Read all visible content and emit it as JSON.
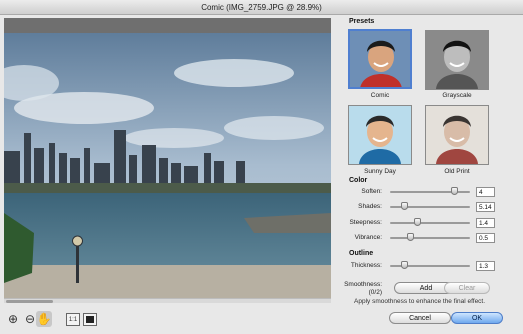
{
  "window": {
    "title": "Comic (IMG_2759.JPG @ 28.9%)"
  },
  "toolbar": {
    "zoom_in_icon": "zoom-in-icon",
    "zoom_out_icon": "zoom-out-icon",
    "hand_icon": "hand-icon",
    "actual_size_label": "1:1",
    "fit_icon": "fit-screen-icon"
  },
  "presets": {
    "heading": "Presets",
    "items": [
      {
        "label": "Comic",
        "selected": true
      },
      {
        "label": "Grayscale",
        "selected": false
      },
      {
        "label": "Sunny Day",
        "selected": false
      },
      {
        "label": "Old Print",
        "selected": false
      }
    ]
  },
  "color": {
    "heading": "Color",
    "soften": {
      "label": "Soften:",
      "value": "4",
      "fraction": 0.8
    },
    "shades": {
      "label": "Shades:",
      "value": "5.14",
      "fraction": 0.18
    },
    "steepness": {
      "label": "Steepness:",
      "value": "1.4",
      "fraction": 0.34
    },
    "vibrance": {
      "label": "Vibrance:",
      "value": "0.5",
      "fraction": 0.25
    }
  },
  "outline": {
    "heading": "Outline",
    "thickness": {
      "label": "Thickness:",
      "value": "1.3",
      "fraction": 0.18
    },
    "smoothness": {
      "label": "Smoothness:",
      "count": "(0/2)"
    },
    "add_label": "Add",
    "clear_label": "Clear",
    "hint": "Apply smoothness to enhance the final effect."
  },
  "buttons": {
    "cancel": "Cancel",
    "ok": "OK"
  },
  "colors": {
    "accent": "#4f7fd0",
    "ok_button": "#6ea8ee"
  }
}
